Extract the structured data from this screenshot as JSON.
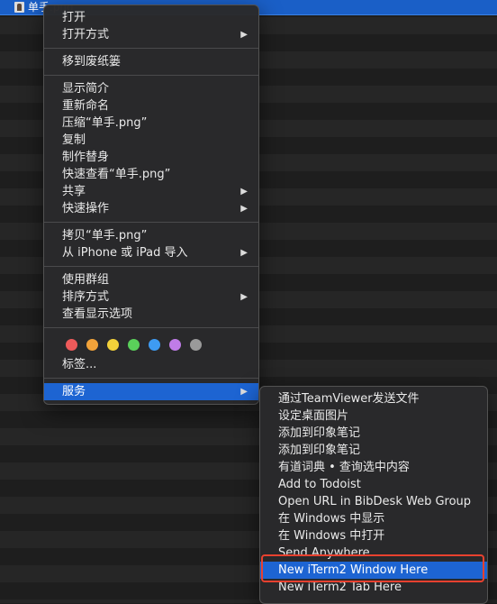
{
  "selected_file": {
    "name": "单手.png"
  },
  "main_menu": {
    "groups": [
      [
        {
          "label": "打开"
        },
        {
          "label": "打开方式",
          "submenu": true
        }
      ],
      [
        {
          "label": "移到废纸篓"
        }
      ],
      [
        {
          "label": "显示简介"
        },
        {
          "label": "重新命名"
        },
        {
          "label": "压缩“单手.png”"
        },
        {
          "label": "复制"
        },
        {
          "label": "制作替身"
        },
        {
          "label": "快速查看“单手.png”"
        },
        {
          "label": "共享",
          "submenu": true
        },
        {
          "label": "快速操作",
          "submenu": true
        }
      ],
      [
        {
          "label": "拷贝“单手.png”"
        },
        {
          "label": "从 iPhone 或 iPad 导入",
          "submenu": true
        }
      ],
      [
        {
          "label": "使用群组"
        },
        {
          "label": "排序方式",
          "submenu": true
        },
        {
          "label": "查看显示选项"
        }
      ]
    ],
    "tag_colors": [
      "#ee5a5a",
      "#f2a33a",
      "#f3d13a",
      "#5ad05a",
      "#3e9bf2",
      "#c07ce8",
      "#9a9a9a"
    ],
    "tags_label": "标签...",
    "services_label": "服务"
  },
  "services_menu": {
    "items": [
      {
        "label": "通过TeamViewer发送文件"
      },
      {
        "label": "设定桌面图片"
      },
      {
        "label": "添加到印象笔记"
      },
      {
        "label": "添加到印象笔记"
      },
      {
        "label": "有道词典 • 查询选中内容"
      },
      {
        "label": "Add to Todoist"
      },
      {
        "label": "Open URL in BibDesk Web Group"
      },
      {
        "label": "在 Windows 中显示"
      },
      {
        "label": "在 Windows 中打开"
      },
      {
        "label": "Send Anywhere"
      },
      {
        "label": "New iTerm2 Window Here",
        "selected": true
      },
      {
        "label": "New iTerm2 Tab Here"
      }
    ]
  },
  "arrow_glyph": "▶",
  "colors": {
    "selection": "#1d64d2",
    "highlight_outline": "#e8412f"
  }
}
